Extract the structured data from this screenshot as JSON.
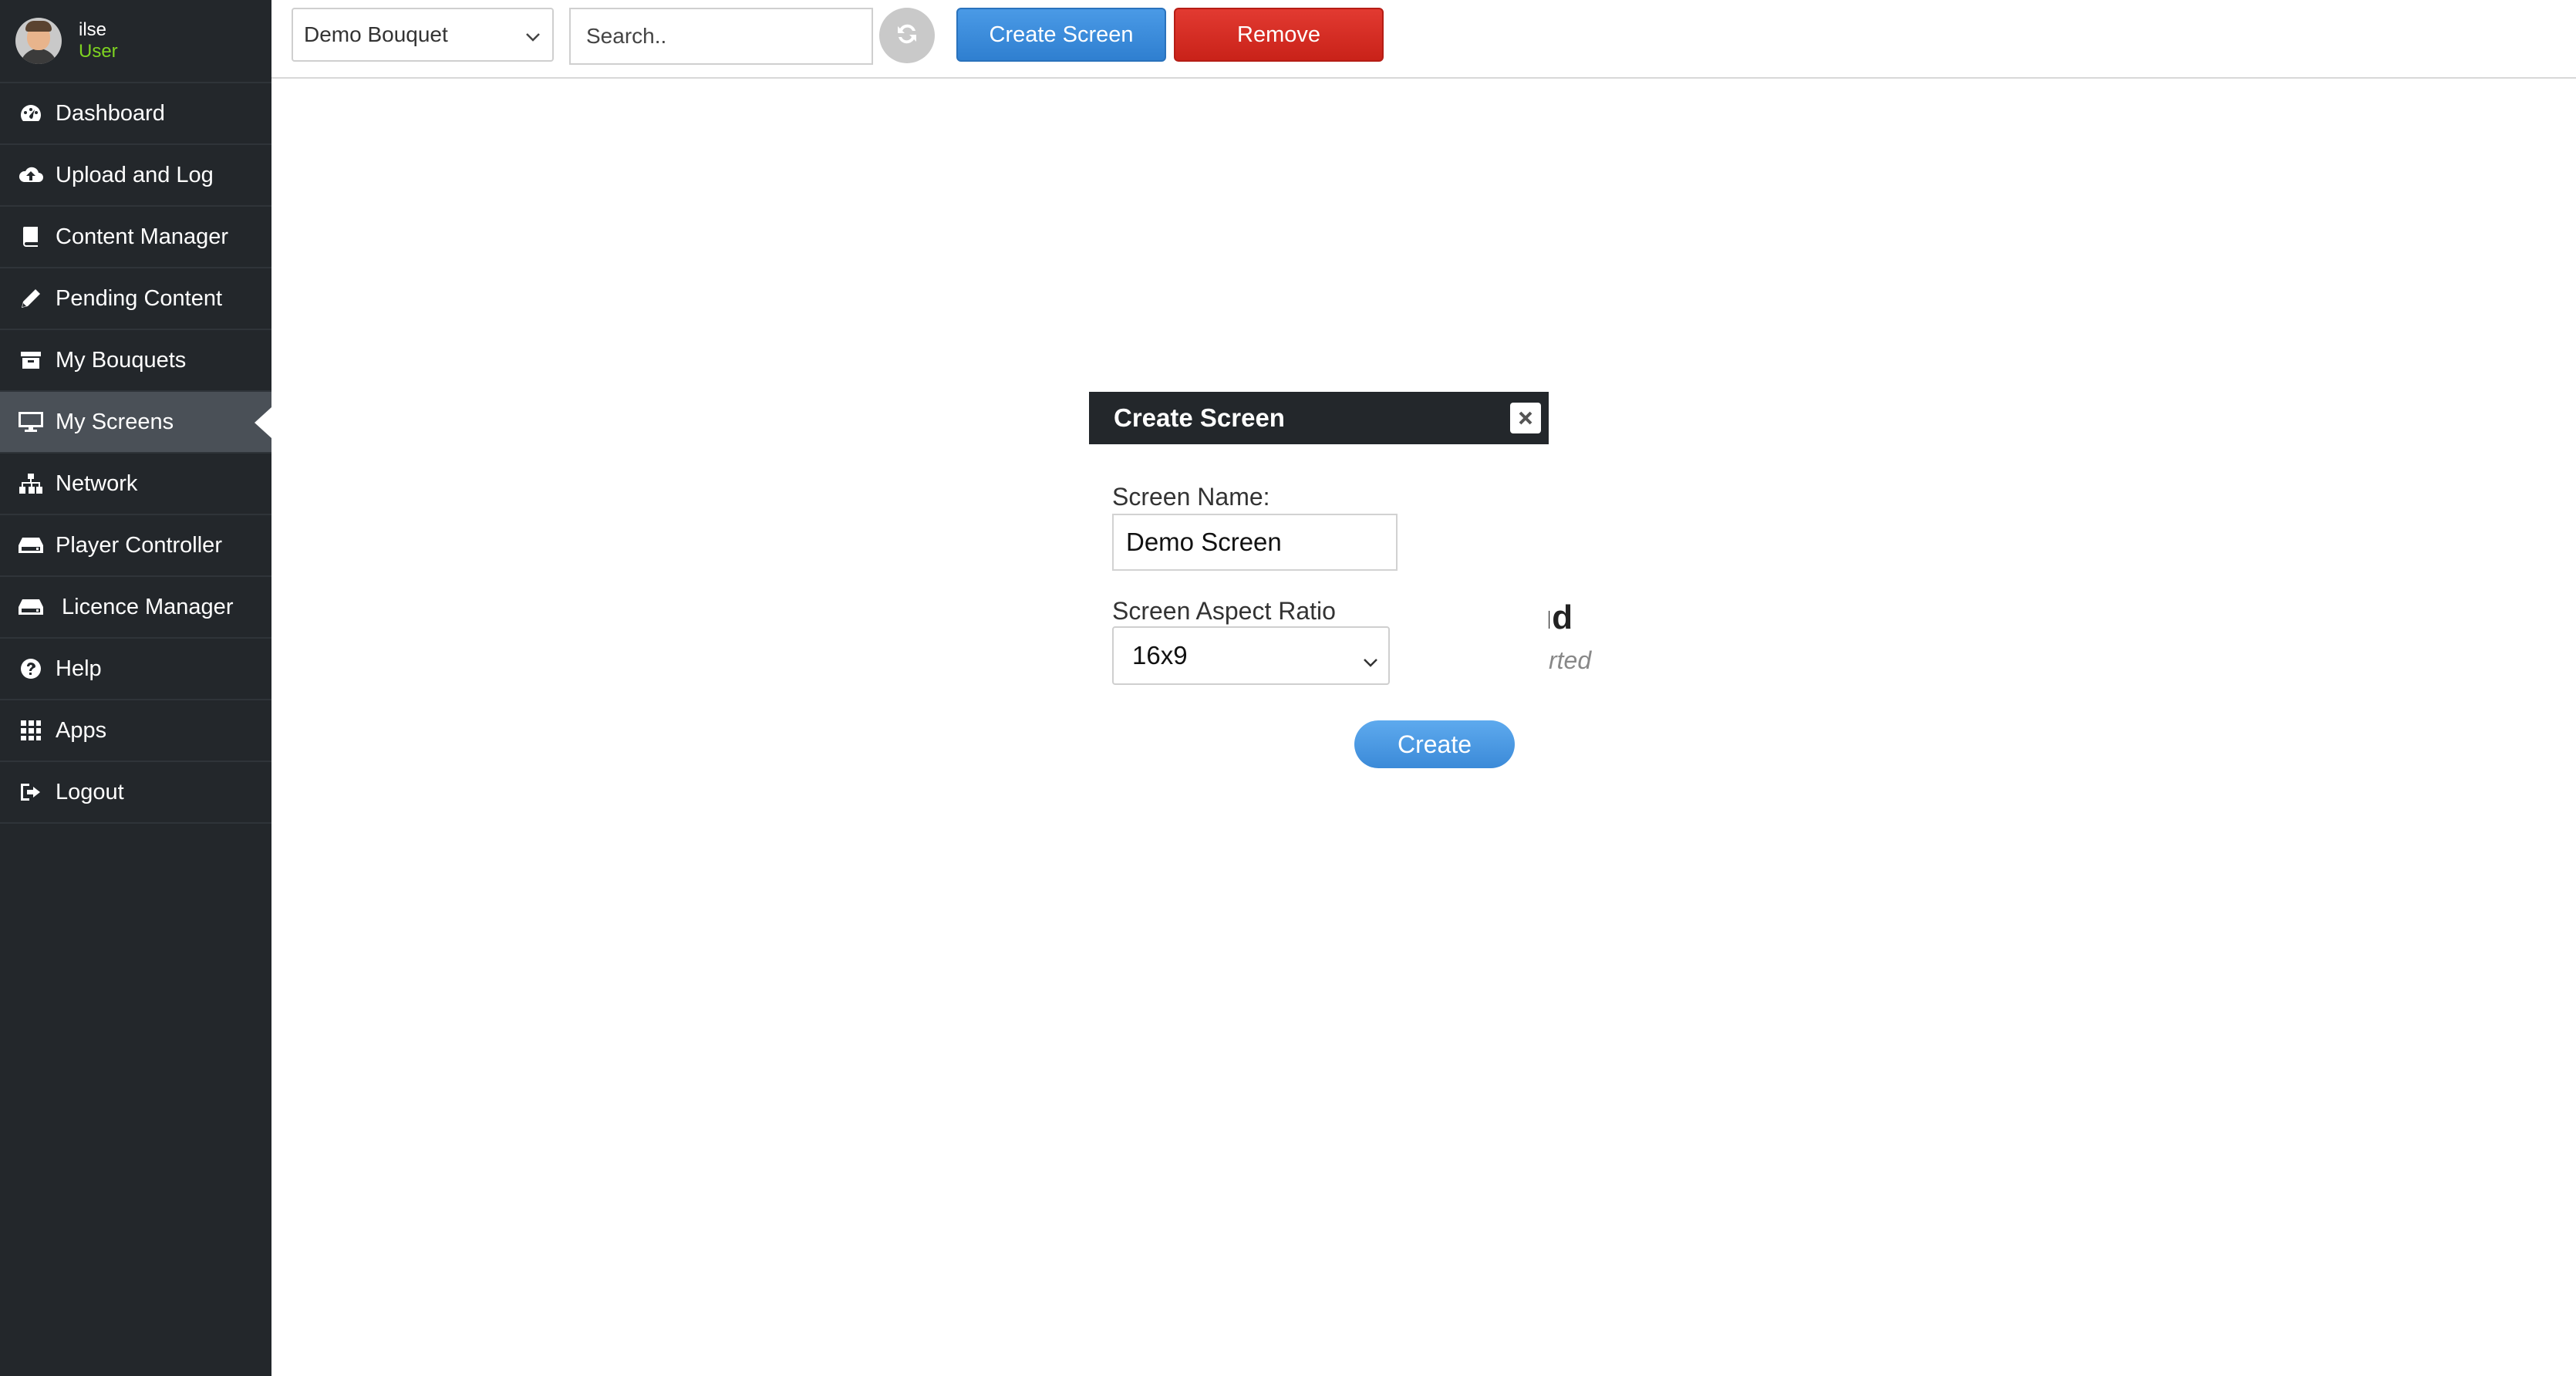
{
  "user": {
    "name": "ilse",
    "role": "User"
  },
  "sidebar": {
    "items": [
      {
        "label": "Dashboard",
        "icon": "dashboard-icon",
        "active": false
      },
      {
        "label": "Upload and Log",
        "icon": "cloud-upload-icon",
        "active": false
      },
      {
        "label": "Content Manager",
        "icon": "book-icon",
        "active": false
      },
      {
        "label": "Pending Content",
        "icon": "pencil-icon",
        "active": false
      },
      {
        "label": "My Bouquets",
        "icon": "archive-icon",
        "active": false
      },
      {
        "label": "My Screens",
        "icon": "desktop-icon",
        "active": true
      },
      {
        "label": "Network",
        "icon": "sitemap-icon",
        "active": false
      },
      {
        "label": "Player Controller",
        "icon": "hdd-icon",
        "active": false
      },
      {
        "label": "Licence Manager",
        "icon": "hdd-icon",
        "active": false
      },
      {
        "label": "Help",
        "icon": "question-circle-icon",
        "active": false
      },
      {
        "label": "Apps",
        "icon": "grid-icon",
        "active": false
      },
      {
        "label": "Logout",
        "icon": "sign-out-icon",
        "active": false
      }
    ]
  },
  "toolbar": {
    "bouquet_selected": "Demo Bouquet",
    "search_placeholder": "Search..",
    "create_label": "Create Screen",
    "remove_label": "Remove"
  },
  "background": {
    "title_fragment": "ıd",
    "subtitle_fragment": "rted"
  },
  "modal": {
    "title": "Create Screen",
    "name_label": "Screen Name:",
    "name_value": "Demo Screen",
    "ratio_label": "Screen Aspect Ratio",
    "ratio_value": "16x9",
    "submit_label": "Create"
  },
  "colors": {
    "sidebar_bg": "#23272b",
    "active_item": "#4a5057",
    "role_green": "#7ed321",
    "primary_blue": "#3a8ad8",
    "danger_red": "#d62b22"
  }
}
